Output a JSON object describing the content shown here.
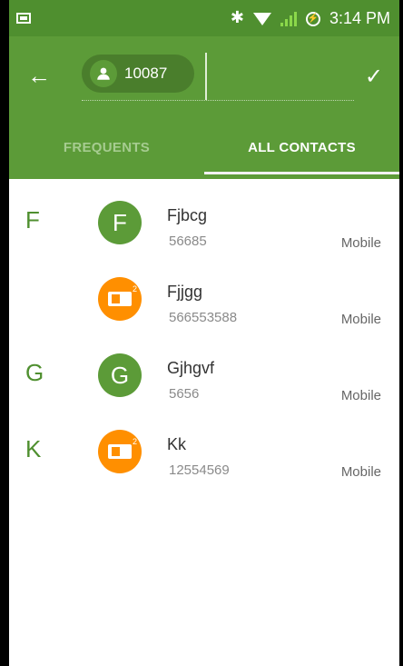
{
  "status": {
    "time": "3:14 PM"
  },
  "appbar": {
    "chip_text": "10087",
    "tabs": [
      {
        "label": "FREQUENTS",
        "active": false
      },
      {
        "label": "ALL CONTACTS",
        "active": true
      }
    ]
  },
  "contacts": [
    {
      "section": "F",
      "name": "Fjbcg",
      "number": "56685",
      "type": "Mobile",
      "avatar": "F"
    },
    {
      "section": "",
      "name": "Fjjgg",
      "number": "566553588",
      "type": "Mobile",
      "avatar": "sim-icon"
    },
    {
      "section": "G",
      "name": "Gjhgvf",
      "number": "5656",
      "type": "Mobile",
      "avatar": "G"
    },
    {
      "section": "K",
      "name": "Kk",
      "number": "12554569",
      "type": "Mobile",
      "avatar": "sim-icon"
    }
  ],
  "colors": {
    "primary": "#5c9b38",
    "primary_dark": "#4f8f2f",
    "accent_orange": "#ff8f00"
  }
}
